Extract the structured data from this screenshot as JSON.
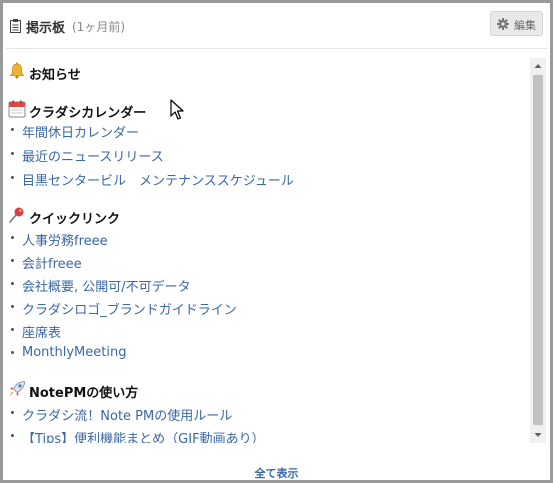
{
  "header": {
    "title": "掲示板",
    "time": "(1ヶ月前)",
    "edit_label": "編集"
  },
  "sections": [
    {
      "title": "お知らせ",
      "icon": "bell-icon",
      "links": []
    },
    {
      "title": "クラダシカレンダー",
      "icon": "calendar-icon",
      "links": [
        "年間休日カレンダー",
        "最近のニュースリリース",
        "目黒センタービル　メンテナンススケジュール"
      ]
    },
    {
      "title": "クイックリンク",
      "icon": "pushpin-icon",
      "links": [
        "人事労務freee",
        "会計freee",
        "会社概要, 公開可/不可データ",
        "クラダシロゴ_ブランドガイドライン",
        "座席表",
        "MonthlyMeeting"
      ]
    },
    {
      "title": "NotePMの使い方",
      "icon": "rocket-icon",
      "links": [
        "クラダシ流！Note PMの使用ルール",
        "【Tips】便利機能まとめ（GIF動画あり）"
      ]
    }
  ],
  "footer": {
    "show_all_label": "全て表示"
  },
  "colors": {
    "link": "#3a67a5",
    "frame_border": "#9a9a9a",
    "scroll_thumb": "#c1c1c1"
  }
}
